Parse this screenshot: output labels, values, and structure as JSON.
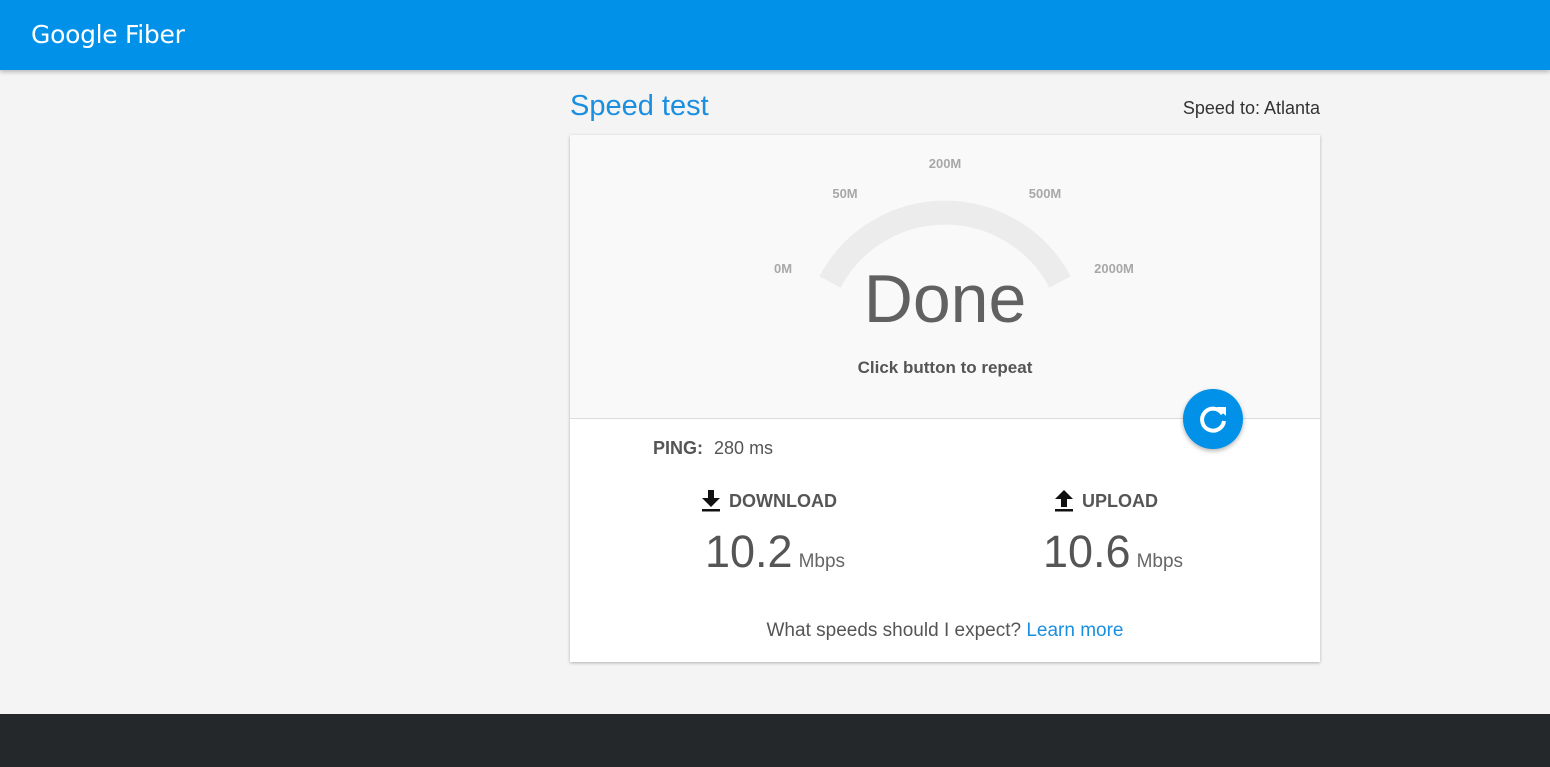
{
  "header": {
    "logo_text": "Google Fiber"
  },
  "page": {
    "title": "Speed test",
    "speed_to": "Speed to: Atlanta"
  },
  "gauge": {
    "ticks": [
      "0M",
      "50M",
      "200M",
      "500M",
      "2000M"
    ],
    "status": "Done",
    "subtext": "Click button to repeat",
    "track_color": "#ececec"
  },
  "repeat_button": {
    "icon": "refresh-icon"
  },
  "results": {
    "ping_label": "PING:",
    "ping_value": "280 ms",
    "download": {
      "label": "DOWNLOAD",
      "icon": "download-icon",
      "value": "10.2",
      "unit": "Mbps"
    },
    "upload": {
      "label": "UPLOAD",
      "icon": "upload-icon",
      "value": "10.6",
      "unit": "Mbps"
    }
  },
  "expect": {
    "question": "What speeds should I expect?",
    "link": "Learn more"
  },
  "colors": {
    "brand_blue": "#0191e8",
    "link_blue": "#1a8fe0",
    "footer": "#25282b",
    "background": "#f4f4f4"
  }
}
